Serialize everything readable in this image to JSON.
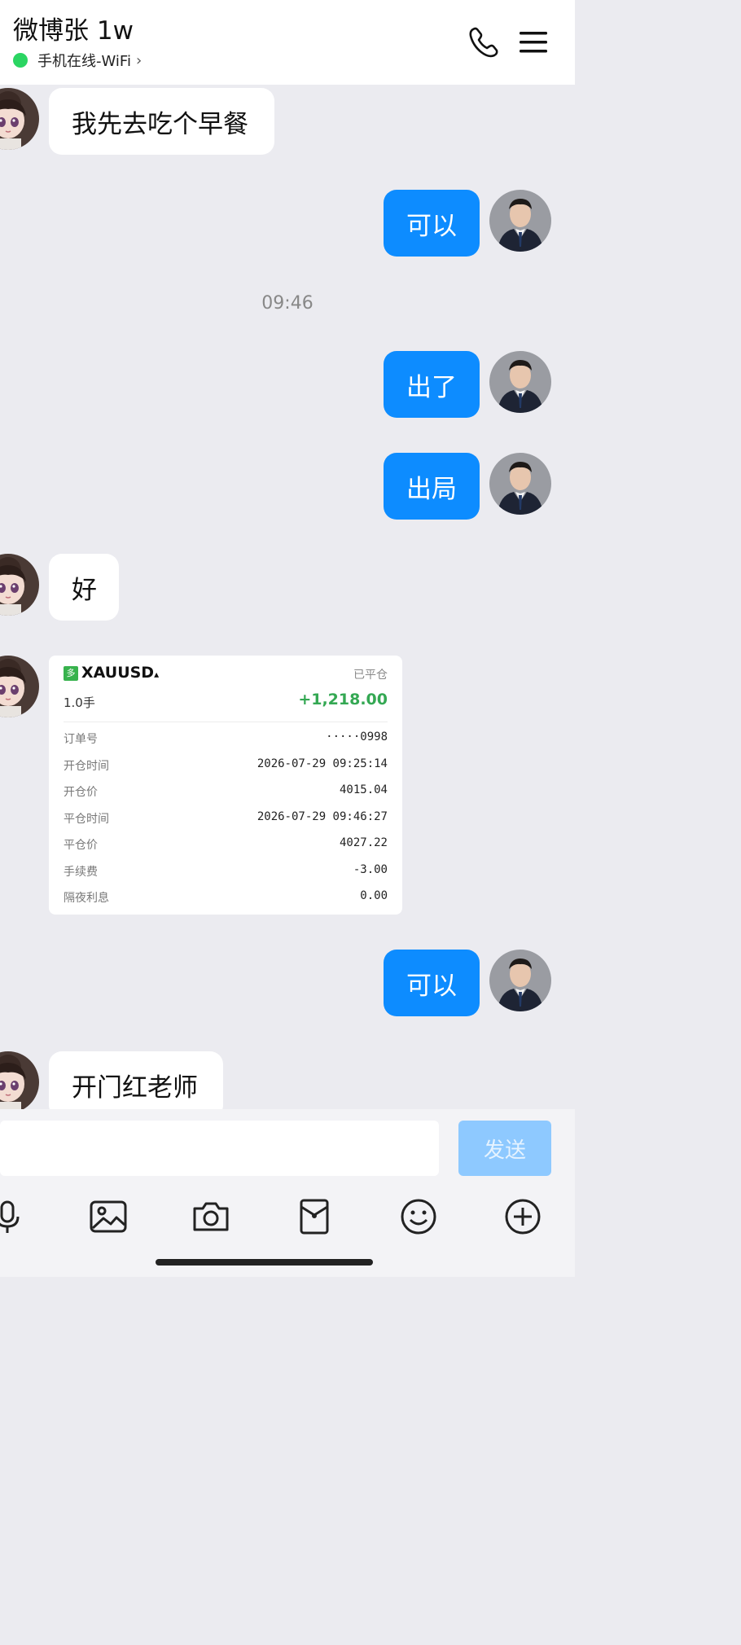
{
  "header": {
    "title": "微博张 1w",
    "status": "手机在线-WiFi",
    "status_chevron": "›",
    "icons": [
      "phone-icon",
      "menu-icon"
    ]
  },
  "messages": [
    {
      "side": "in",
      "text": "我先去吃个早餐"
    },
    {
      "side": "out",
      "text": "可以"
    },
    {
      "type": "time",
      "text": "09:46"
    },
    {
      "side": "out",
      "text": "出了"
    },
    {
      "side": "out",
      "text": "出局"
    },
    {
      "side": "in",
      "text": "好"
    },
    {
      "side": "in",
      "type": "trade_card"
    },
    {
      "side": "out",
      "text": "可以"
    },
    {
      "side": "in",
      "text": "开门红老师"
    }
  ],
  "trade_card": {
    "badge": "多",
    "symbol": "XAUUSD",
    "symbol_arrow": "▴",
    "status": "已平仓",
    "lots": "1.0手",
    "profit": "+1,218.00",
    "profit_color": "#34a853",
    "rows": [
      {
        "label": "订单号",
        "value": "·····0998"
      },
      {
        "label": "开仓时间",
        "value": "2026-07-29 09:25:14"
      },
      {
        "label": "开仓价",
        "value": "4015.04"
      },
      {
        "label": "平仓时间",
        "value": "2026-07-29 09:46:27"
      },
      {
        "label": "平仓价",
        "value": "4027.22"
      },
      {
        "label": "手续费",
        "value": "-3.00"
      },
      {
        "label": "隔夜利息",
        "value": "0.00"
      }
    ]
  },
  "input": {
    "send_label": "发送",
    "tools": [
      "mic-icon",
      "image-icon",
      "camera-icon",
      "red-packet-icon",
      "emoji-icon",
      "plus-icon"
    ]
  },
  "colors": {
    "accent": "#0d8cff",
    "background": "#ebebf0",
    "online": "#2bd562"
  }
}
